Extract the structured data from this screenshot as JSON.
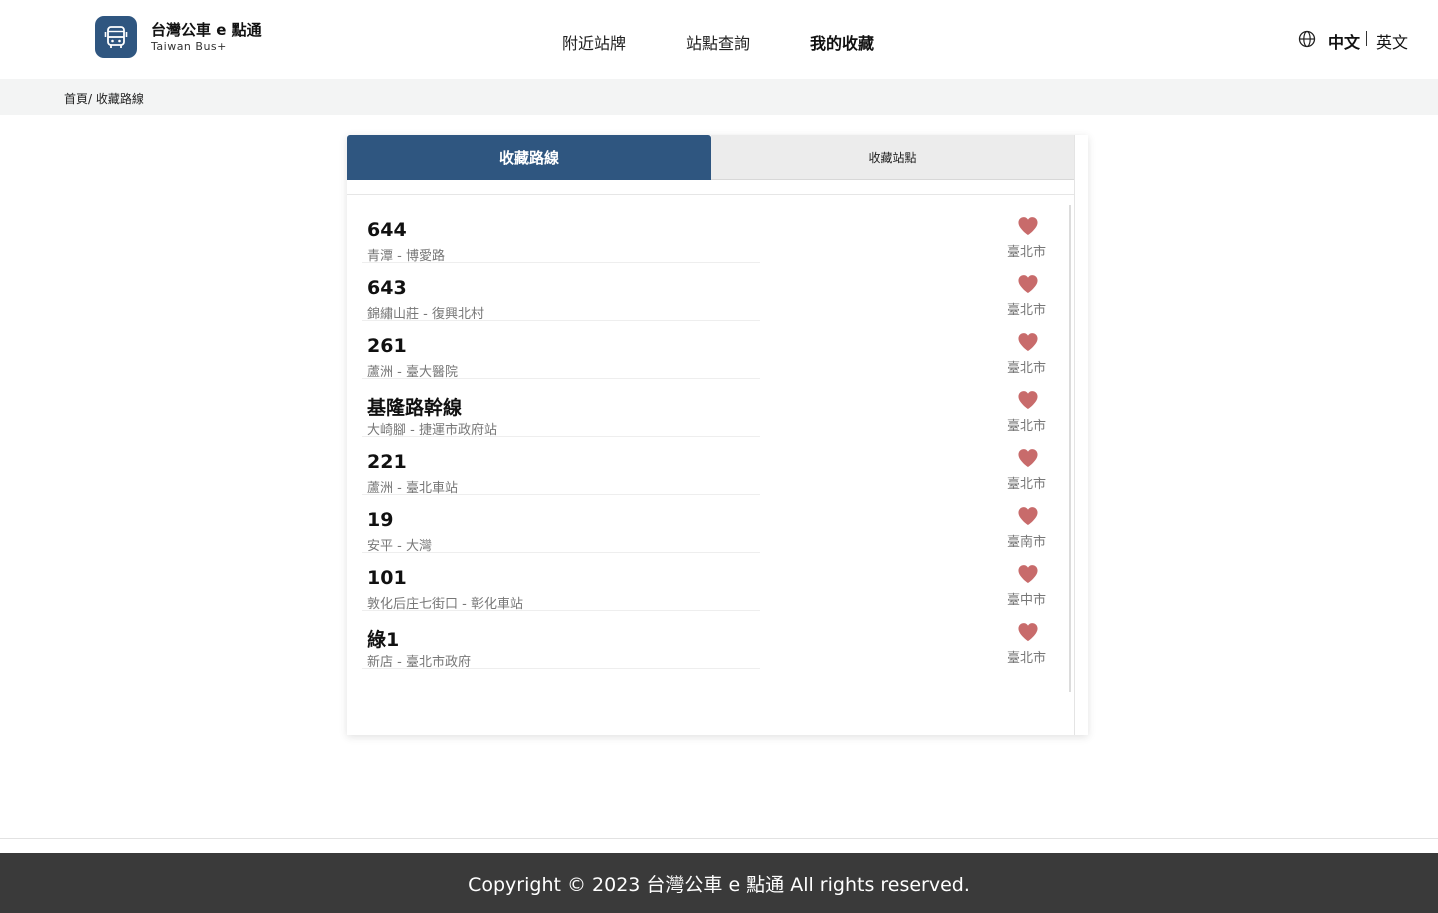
{
  "brand": {
    "title": "台灣公車 e 點通",
    "subtitle": "Taiwan Bus+",
    "color": "#2f5680"
  },
  "nav": [
    {
      "label": "附近站牌",
      "active": false
    },
    {
      "label": "站點查詢",
      "active": false
    },
    {
      "label": "我的收藏",
      "active": true
    }
  ],
  "language": {
    "icon": "globe-icon",
    "current": "中文",
    "other": "英文"
  },
  "breadcrumb": "首頁/ 收藏路線",
  "tabs": {
    "routes": "收藏路線",
    "stops": "收藏站點",
    "active": "routes"
  },
  "routes": [
    {
      "number": "644",
      "description": "青潭 - 博愛路",
      "city": "臺北市"
    },
    {
      "number": "643",
      "description": "錦繡山莊 - 復興北村",
      "city": "臺北市"
    },
    {
      "number": "261",
      "description": "蘆洲 - 臺大醫院",
      "city": "臺北市"
    },
    {
      "number": "基隆路幹線",
      "description": "大崎腳 - 捷運市政府站",
      "city": "臺北市"
    },
    {
      "number": "221",
      "description": "蘆洲 - 臺北車站",
      "city": "臺北市"
    },
    {
      "number": "19",
      "description": "安平 - 大灣",
      "city": "臺南市"
    },
    {
      "number": "101",
      "description": "敦化后庄七街口 - 彰化車站",
      "city": "臺中市"
    },
    {
      "number": "綠1",
      "description": "新店 - 臺北市政府",
      "city": "臺北市"
    }
  ],
  "favorite_icon": "heart-icon",
  "favorite_color": "#c86b6b",
  "footer": "Copyright © 2023 台灣公車 e 點通 All rights reserved."
}
